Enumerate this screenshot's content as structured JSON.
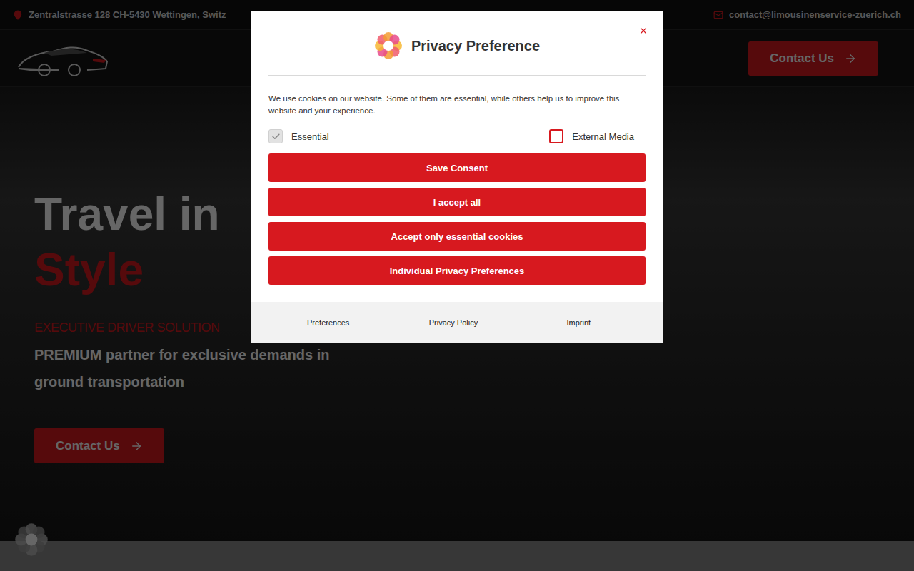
{
  "topbar": {
    "address": "Zentralstrasse 128 CH-5430 Wettingen, Switz",
    "email": "contact@limousinenservice-zuerich.ch"
  },
  "header": {
    "cta": "Contact Us"
  },
  "hero": {
    "title_line1": "Travel in",
    "title_line2": "Style",
    "kicker": "EXECUTIVE DRIVER SOLUTION",
    "subtitle": "PREMIUM partner for exclusive demands in ground transportation",
    "cta": "Contact Us"
  },
  "modal": {
    "title": "Privacy Preference",
    "description": "We use cookies on our website. Some of them are essential, while others help us to improve this website and your experience.",
    "options": [
      {
        "label": "Essential",
        "checked": true,
        "disabled": true
      },
      {
        "label": "External Media",
        "checked": false,
        "disabled": false
      }
    ],
    "buttons": [
      "Save Consent",
      "I accept all",
      "Accept only essential cookies",
      "Individual Privacy Preferences"
    ],
    "footer_links": [
      "Preferences",
      "Privacy Policy",
      "Imprint"
    ]
  }
}
